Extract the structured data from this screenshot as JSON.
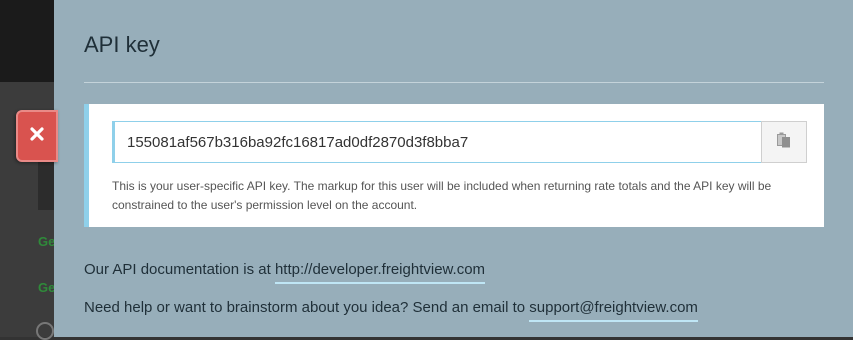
{
  "panel": {
    "title": "API key",
    "close_icon": "close-icon"
  },
  "api_key": {
    "value": "155081af567b316ba92fc16817ad0df2870d3f8bba7",
    "copy_icon": "clipboard-icon",
    "help_text": "This is your user-specific API key. The markup for this user will be included when returning rate totals and the API key will be constrained to the user's permission level on the account."
  },
  "docs": {
    "prefix": "Our API documentation is at ",
    "link_text": "http://developer.freightview.com"
  },
  "support": {
    "prefix": "Need help or want to brainstorm about you idea? Send an email to ",
    "link_text": "support@freightview.com"
  },
  "background": {
    "fragments": [
      "Ge",
      "Ge"
    ]
  },
  "colors": {
    "panel_bg": "#97aeba",
    "close_button": "#d9534f",
    "accent": "#8fd0ea"
  }
}
